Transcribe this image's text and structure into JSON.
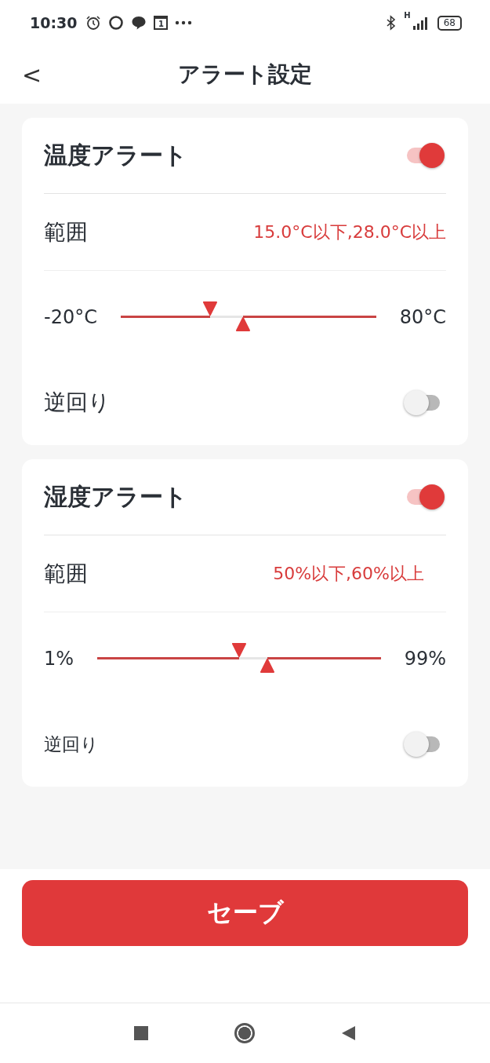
{
  "status_bar": {
    "time": "10:30",
    "calendar_day": "1",
    "network_type": "H",
    "battery": "68"
  },
  "header": {
    "back": "<",
    "title": "アラート設定"
  },
  "cards": [
    {
      "title": "温度アラート",
      "enabled": true,
      "range_label": "範囲",
      "range_value": "15.0°C以下,28.0°C以上",
      "min_label": "-20°C",
      "max_label": "80°C",
      "thumbs": [
        {
          "kind": "lower",
          "level": 0.35
        },
        {
          "kind": "upper",
          "level": 0.48
        }
      ],
      "reverse_label": "逆回り",
      "reverse": false
    },
    {
      "title": "湿度アラート",
      "enabled": true,
      "range_label": "範囲",
      "range_value": "50%以下,60%以上",
      "min_label": "1%",
      "max_label": "99%",
      "thumbs": [
        {
          "kind": "lower",
          "level": 0.5
        },
        {
          "kind": "upper",
          "level": 0.6
        }
      ],
      "reverse_label": "逆回り",
      "reverse": false
    }
  ],
  "save_button": "セーブ"
}
